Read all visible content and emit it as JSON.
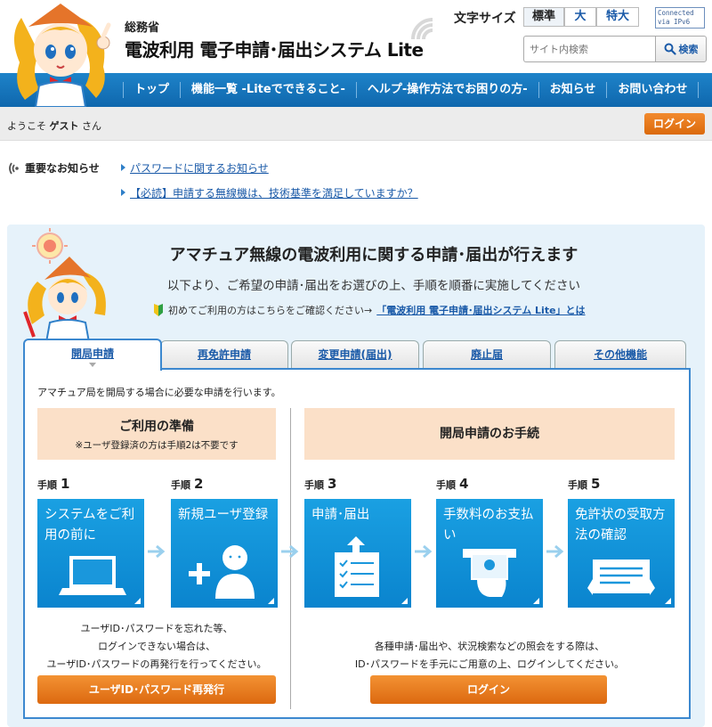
{
  "header": {
    "ministry": "総務省",
    "title": "電波利用 電子申請･届出システム Lite",
    "font_size_label": "文字サイズ",
    "font_size_options": [
      "標準",
      "大",
      "特大"
    ],
    "ipv6_badge": [
      "Connected",
      "via IPv6"
    ],
    "search_placeholder": "サイト内検索",
    "search_button": "検索"
  },
  "nav": {
    "items": [
      "トップ",
      "機能一覧 -Liteでできること-",
      "ヘルプ-操作方法でお困りの方-",
      "お知らせ",
      "お問い合わせ"
    ]
  },
  "userbar": {
    "welcome_prefix": "ようこそ",
    "user": "ゲスト",
    "welcome_suffix": "さん",
    "login_button": "ログイン"
  },
  "notices": {
    "heading": "重要なお知らせ",
    "items": [
      "パスワードに関するお知らせ",
      "【必読】申請する無線機は、技術基準を満足していますか？"
    ]
  },
  "main": {
    "title": "アマチュア無線の電波利用に関する申請･届出が行えます",
    "subtitle": "以下より、ご希望の申請･届出をお選びの上、手順を順番に実施してください",
    "beginner_text": "初めてご利用の方はこちらをご確認ください→",
    "beginner_link": "「電波利用 電子申請･届出システム Lite」とは"
  },
  "tabs": [
    "開局申請",
    "再免許申請",
    "変更申請(届出)",
    "廃止届",
    "その他機能"
  ],
  "active_tab": "開局申請",
  "tab_content": {
    "description": "アマチュア局を開局する場合に必要な申請を行います。",
    "prep_title": "ご利用の準備",
    "prep_note": "※ユーザ登録済の方は手順2は不要です",
    "proc_title": "開局申請のお手続",
    "step_prefix": "手順",
    "steps": [
      {
        "num": "1",
        "title": "システムをご利用の前に",
        "icon": "laptop-icon"
      },
      {
        "num": "2",
        "title": "新規ユーザ登録",
        "icon": "add-user-icon"
      },
      {
        "num": "3",
        "title": "申請･届出",
        "icon": "checklist-upload-icon"
      },
      {
        "num": "4",
        "title": "手数料のお支払い",
        "icon": "payment-icon"
      },
      {
        "num": "5",
        "title": "免許状の受取方法の確認",
        "icon": "license-icon"
      }
    ],
    "help_left": [
      "ユーザID･パスワードを忘れた等、",
      "ログインできない場合は、",
      "ユーザID･パスワードの再発行を行ってください。"
    ],
    "help_right": [
      "各種申請･届出や、状況検索などの照会をする際は、",
      "ID･パスワードを手元にご用意の上、ログインしてください。"
    ],
    "reissue_button": "ユーザID･パスワード再発行",
    "login_button": "ログイン"
  },
  "colors": {
    "nav_blue": "#1477bf",
    "card_blue": "#0f8fd6",
    "orange": "#e8781c",
    "panel_bg": "#e6f2fa",
    "peach": "#fbe0c8"
  }
}
